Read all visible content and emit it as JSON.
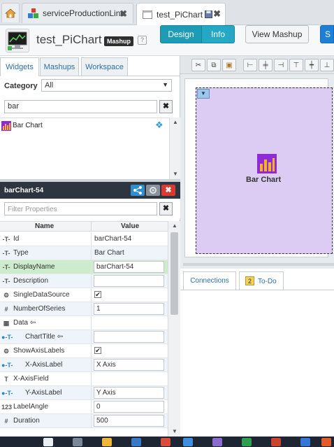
{
  "tabs": [
    {
      "label": "serviceProductionLine",
      "close": "✖"
    },
    {
      "label": "test_PiChart",
      "close": "✖"
    }
  ],
  "header": {
    "title": "test_PiChart",
    "badge": "Mashup",
    "help": "?",
    "design_label": "Design",
    "info_label": "Info",
    "view_mashup_label": "View Mashup",
    "extra_label": "S"
  },
  "left_tabs": [
    "Widgets",
    "Mashups",
    "Workspace"
  ],
  "category": {
    "label": "Category",
    "value": "All"
  },
  "search": {
    "value": "bar",
    "clear": "✖"
  },
  "widget_list": [
    {
      "label": "Bar Chart"
    }
  ],
  "properties_panel": {
    "title": "barChart-54",
    "filter_placeholder": "Filter Properties",
    "col_name": "Name",
    "col_value": "Value",
    "rows": [
      {
        "icon": "-T-",
        "name": "Id",
        "value": "barChart-54",
        "kind": "text"
      },
      {
        "icon": "-T-",
        "name": "Type",
        "value": "Bar Chart",
        "kind": "text"
      },
      {
        "icon": "-T-",
        "name": "DisplayName",
        "value": "barChart-54",
        "kind": "input",
        "highlight": true
      },
      {
        "icon": "-T-",
        "name": "Description",
        "value": "",
        "kind": "input"
      },
      {
        "icon": "⚙",
        "name": "SingleDataSource",
        "value": "✔",
        "kind": "check"
      },
      {
        "icon": "#",
        "name": "NumberOfSeries",
        "value": "1",
        "kind": "input"
      },
      {
        "icon": "▦",
        "name": "Data ⇦",
        "value": "",
        "kind": "none"
      },
      {
        "icon": "●-T-",
        "name": "ChartTitle ⇦",
        "value": "",
        "kind": "input"
      },
      {
        "icon": "⚙",
        "name": "ShowAxisLabels",
        "value": "✔",
        "kind": "check"
      },
      {
        "icon": "●-T-",
        "name": "X-AxisLabel",
        "value": "X Axis",
        "kind": "input"
      },
      {
        "icon": "T",
        "name": "X-AxisField",
        "value": "",
        "kind": "none"
      },
      {
        "icon": "●-T-",
        "name": "Y-AxisLabel",
        "value": "Y Axis",
        "kind": "input"
      },
      {
        "icon": "123",
        "name": "LabelAngle",
        "value": "0",
        "kind": "input"
      },
      {
        "icon": "#",
        "name": "Duration",
        "value": "500",
        "kind": "input"
      }
    ]
  },
  "canvas": {
    "widget_label": "Bar Chart"
  },
  "bottom_tabs": [
    "Connections",
    "To-Do"
  ],
  "todo_count": "2",
  "colors": {
    "accent": "#1e9bb5",
    "canvas_bg": "#dccbf3",
    "highlight_row": "#cdeccb",
    "panel_header": "#2d3540"
  }
}
